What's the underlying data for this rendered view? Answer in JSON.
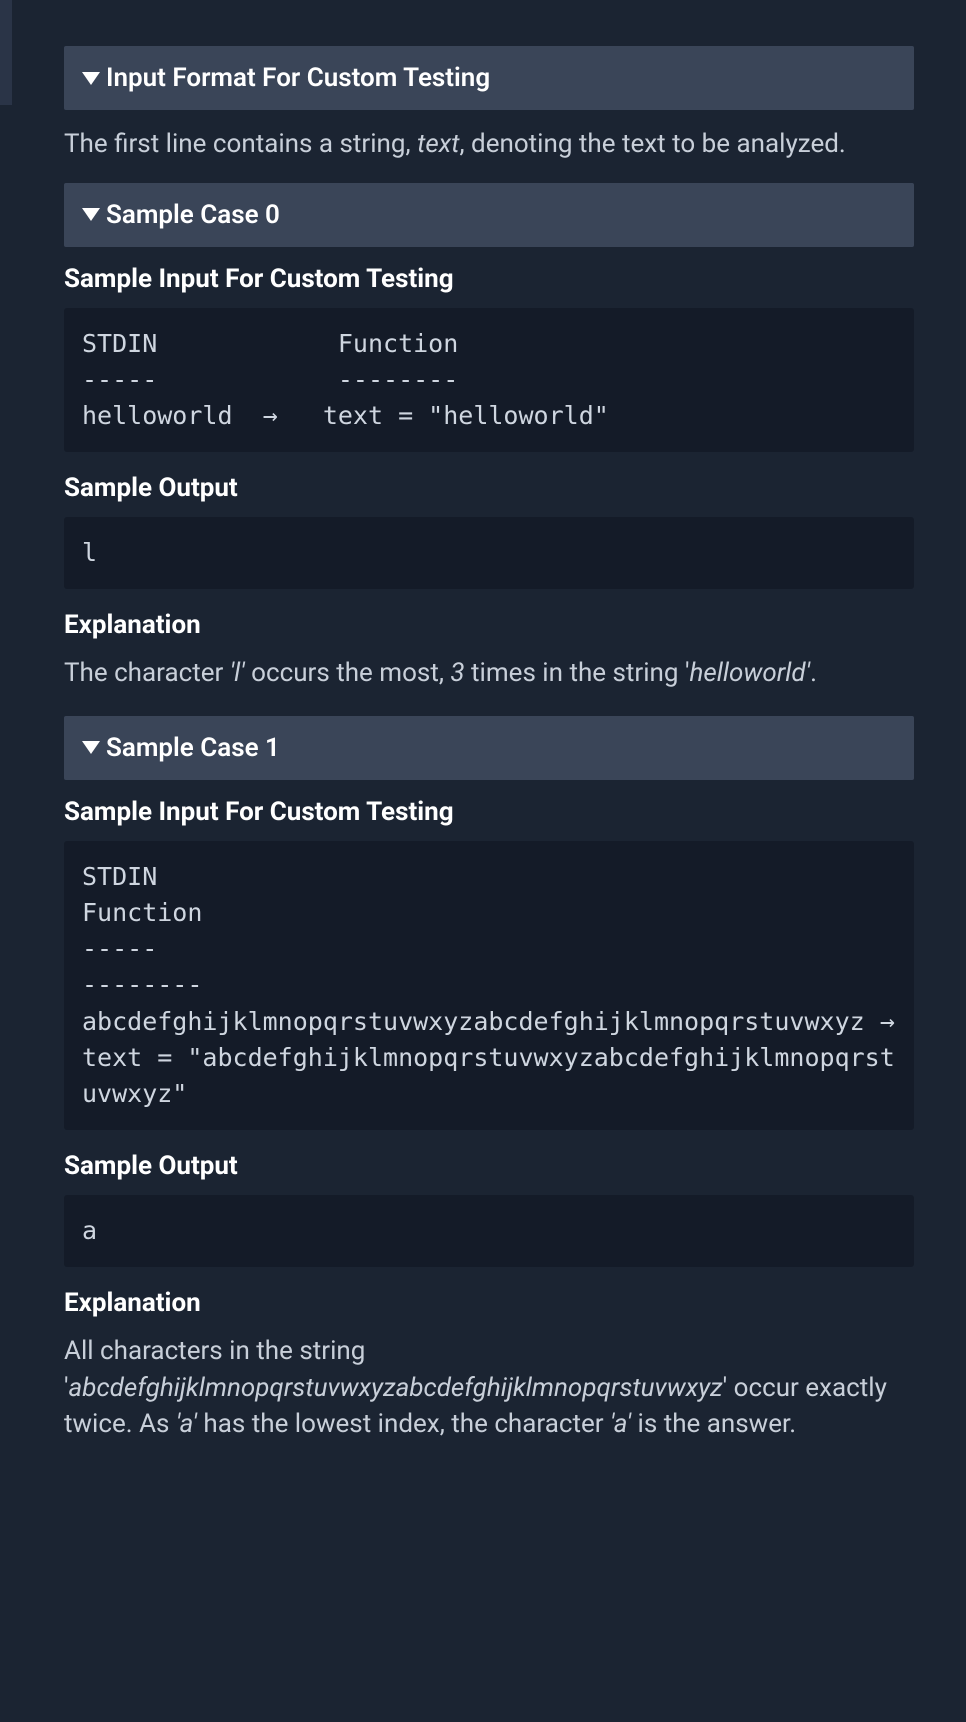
{
  "sections": {
    "input_format": {
      "title": "Input Format For Custom Testing",
      "desc_pre": "The first line contains a string, ",
      "desc_em": "text",
      "desc_post": ", denoting the text to be analyzed."
    },
    "case0": {
      "title": "Sample Case 0",
      "input_heading": "Sample Input For Custom Testing",
      "input_code": "STDIN            Function\n-----            --------\nhelloworld  →   text = \"helloworld\"",
      "output_heading": "Sample Output",
      "output_code": "l",
      "expl_heading": "Explanation",
      "expl_pre": "The character ",
      "expl_em1": "'l'",
      "expl_mid1": " occurs the most, ",
      "expl_em2": "3",
      "expl_mid2": " times in the string '",
      "expl_em3": "helloworld'",
      "expl_post": "."
    },
    "case1": {
      "title": "Sample Case 1",
      "input_heading": "Sample Input For Custom Testing",
      "input_code": "STDIN\nFunction\n-----\n--------\nabcdefghijklmnopqrstuvwxyzabcdefghijklmnopqrstuvwxyz →   text = \"abcdefghijklmnopqrstuvwxyzabcdefghijklmnopqrstuvwxyz\"",
      "output_heading": "Sample Output",
      "output_code": "a",
      "expl_heading": "Explanation",
      "expl_pre": "All characters in the string '",
      "expl_em1": "abcdefghijklmnopqrstuvwxyzabcdefghijklmnopqrstuvwxyz",
      "expl_mid1": "' occur exactly twice. As ",
      "expl_em2": "'a'",
      "expl_mid2": " has the lowest index, the character ",
      "expl_em3": "'a'",
      "expl_post": " is the answer."
    }
  }
}
